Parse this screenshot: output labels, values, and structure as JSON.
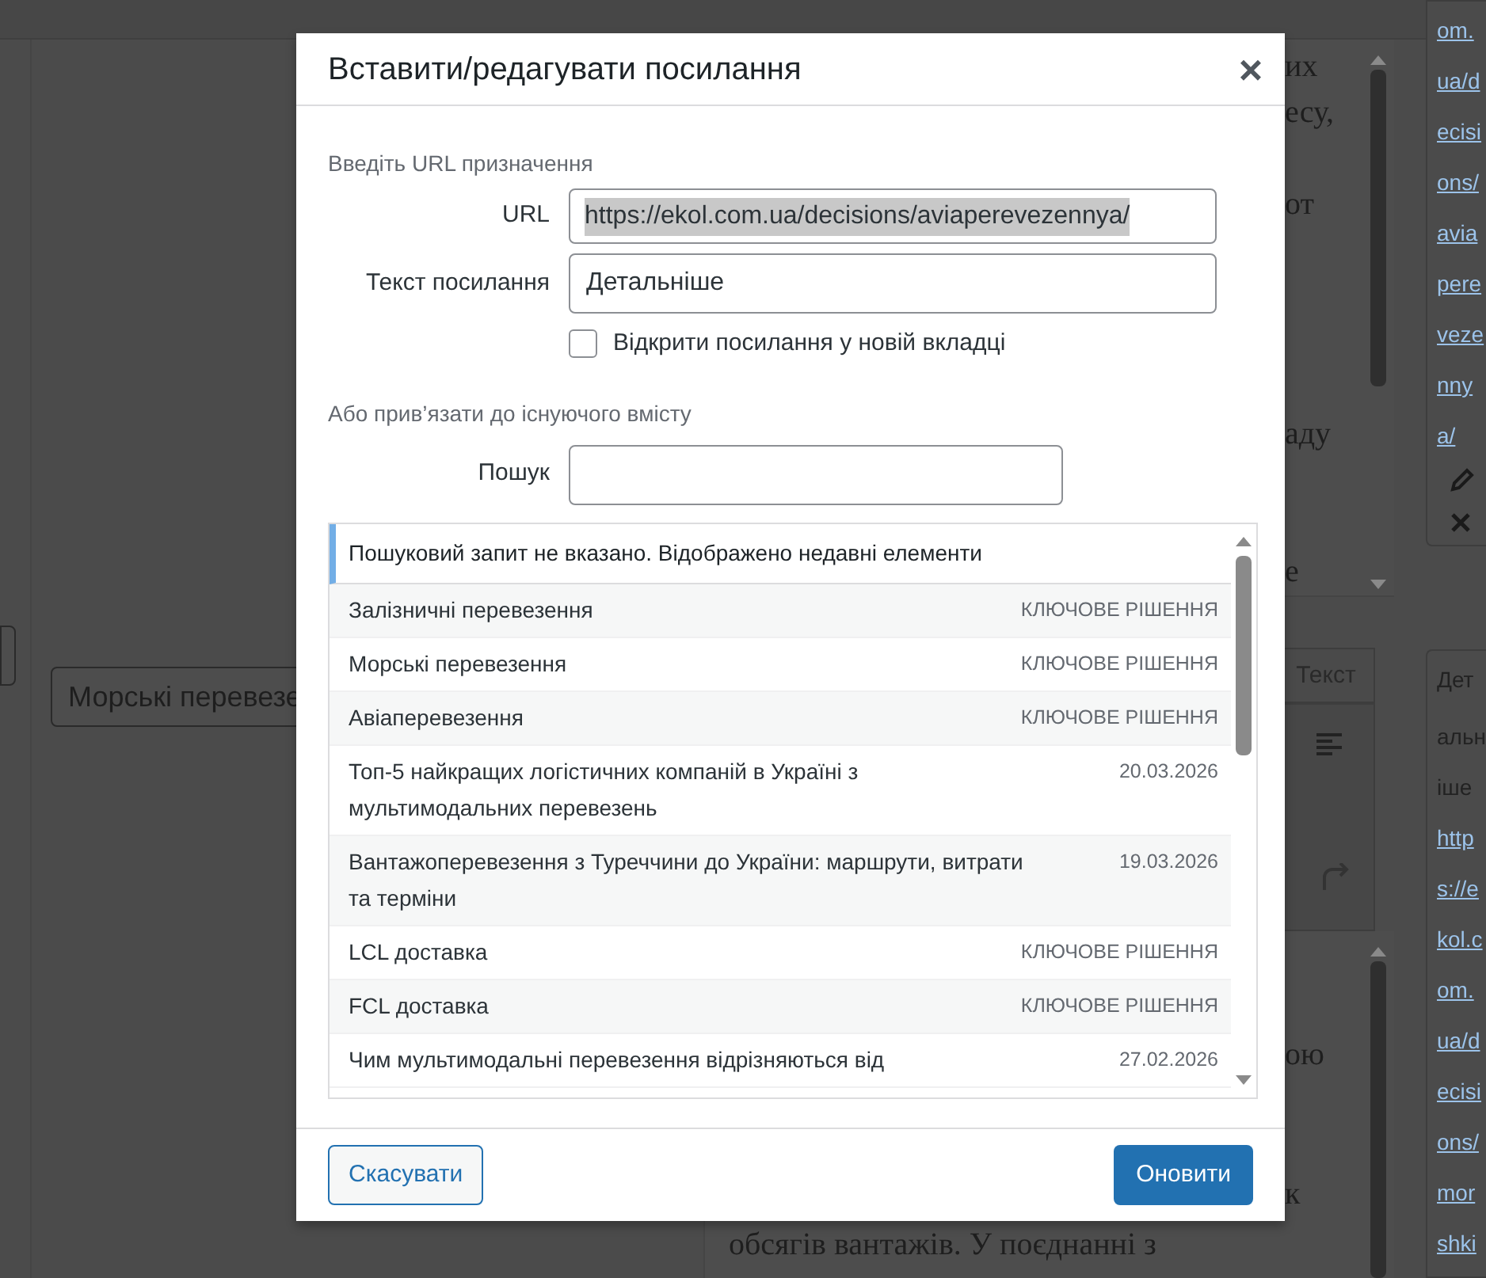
{
  "background": {
    "left_field": {
      "value": "Морські перевезе"
    },
    "editor_fragments_top": [
      [
        "их",
        "есу,"
      ],
      [
        "от"
      ],
      [
        "аду"
      ],
      [
        "е"
      ]
    ],
    "editor_tab": "Текст",
    "editor_fragments_bottom": [
      [
        "ою"
      ],
      [
        "к"
      ]
    ],
    "editor_line_below": "обсягів вантажів. У поєднанні з",
    "side_links_top": [
      "om.",
      "ua/d",
      "ecisi",
      "ons/",
      "avia",
      "pere",
      "veze",
      "nny",
      "a/"
    ],
    "side_tab": "Дет",
    "side_text": [
      "альн",
      "іше"
    ],
    "side_links_bottom": [
      "http",
      "s://e",
      "kol.c",
      "om.",
      "ua/d",
      "ecisi",
      "ons/",
      "mor",
      "shki"
    ]
  },
  "dialog": {
    "title": "Вставити/редагувати посилання",
    "close": "×",
    "url_section": "Введіть URL призначення",
    "url": {
      "label": "URL",
      "value": "https://ekol.com.ua/decisions/aviaperevezennya/"
    },
    "link_text": {
      "label": "Текст посилання",
      "value": "Детальніше"
    },
    "new_tab": {
      "label": "Відкрити посилання у новій вкладці",
      "checked": false
    },
    "link_section": "Або прив’язати до існуючого вмісту",
    "search": {
      "label": "Пошук"
    },
    "results_notice": "Пошуковий запит не вказано. Відображено недавні елементи",
    "results": [
      {
        "title": "Залізничні перевезення",
        "info": "КЛЮЧОВЕ РІШЕННЯ"
      },
      {
        "title": "Морські перевезення",
        "info": "КЛЮЧОВЕ РІШЕННЯ"
      },
      {
        "title": "Авіаперевезення",
        "info": "КЛЮЧОВЕ РІШЕННЯ"
      },
      {
        "title": "Топ-5 найкращих логістичних компаній в Україні з мультимодальних перевезень",
        "info": "20.03.2026"
      },
      {
        "title": "Вантажоперевезення з Туреччини до України: маршрути, витрати та терміни",
        "info": "19.03.2026"
      },
      {
        "title": "LCL доставка",
        "info": "КЛЮЧОВЕ РІШЕННЯ"
      },
      {
        "title": "FCL доставка",
        "info": "КЛЮЧОВЕ РІШЕННЯ"
      },
      {
        "title": "Чим мультимодальні перевезення відрізняються від",
        "info": "27.02.2026"
      }
    ],
    "buttons": {
      "cancel": "Скасувати",
      "update": "Оновити"
    }
  }
}
